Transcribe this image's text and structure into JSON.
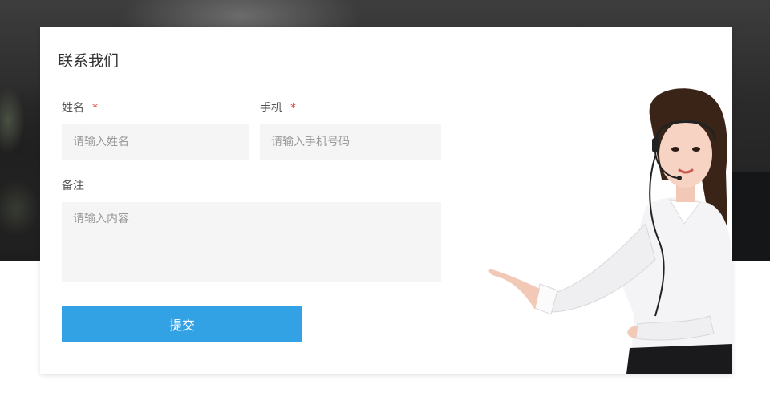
{
  "contact_form": {
    "title": "联系我们",
    "name_label": "姓名",
    "name_placeholder": "请输入姓名",
    "phone_label": "手机",
    "phone_placeholder": "请输入手机号码",
    "required_mark": "*",
    "notes_label": "备注",
    "notes_placeholder": "请输入内容",
    "submit_label": "提交"
  },
  "colors": {
    "accent": "#33a2e5",
    "required": "#e23b3b",
    "input_bg": "#f5f5f5"
  },
  "illustration": {
    "icon": "customer-service-agent-icon"
  }
}
